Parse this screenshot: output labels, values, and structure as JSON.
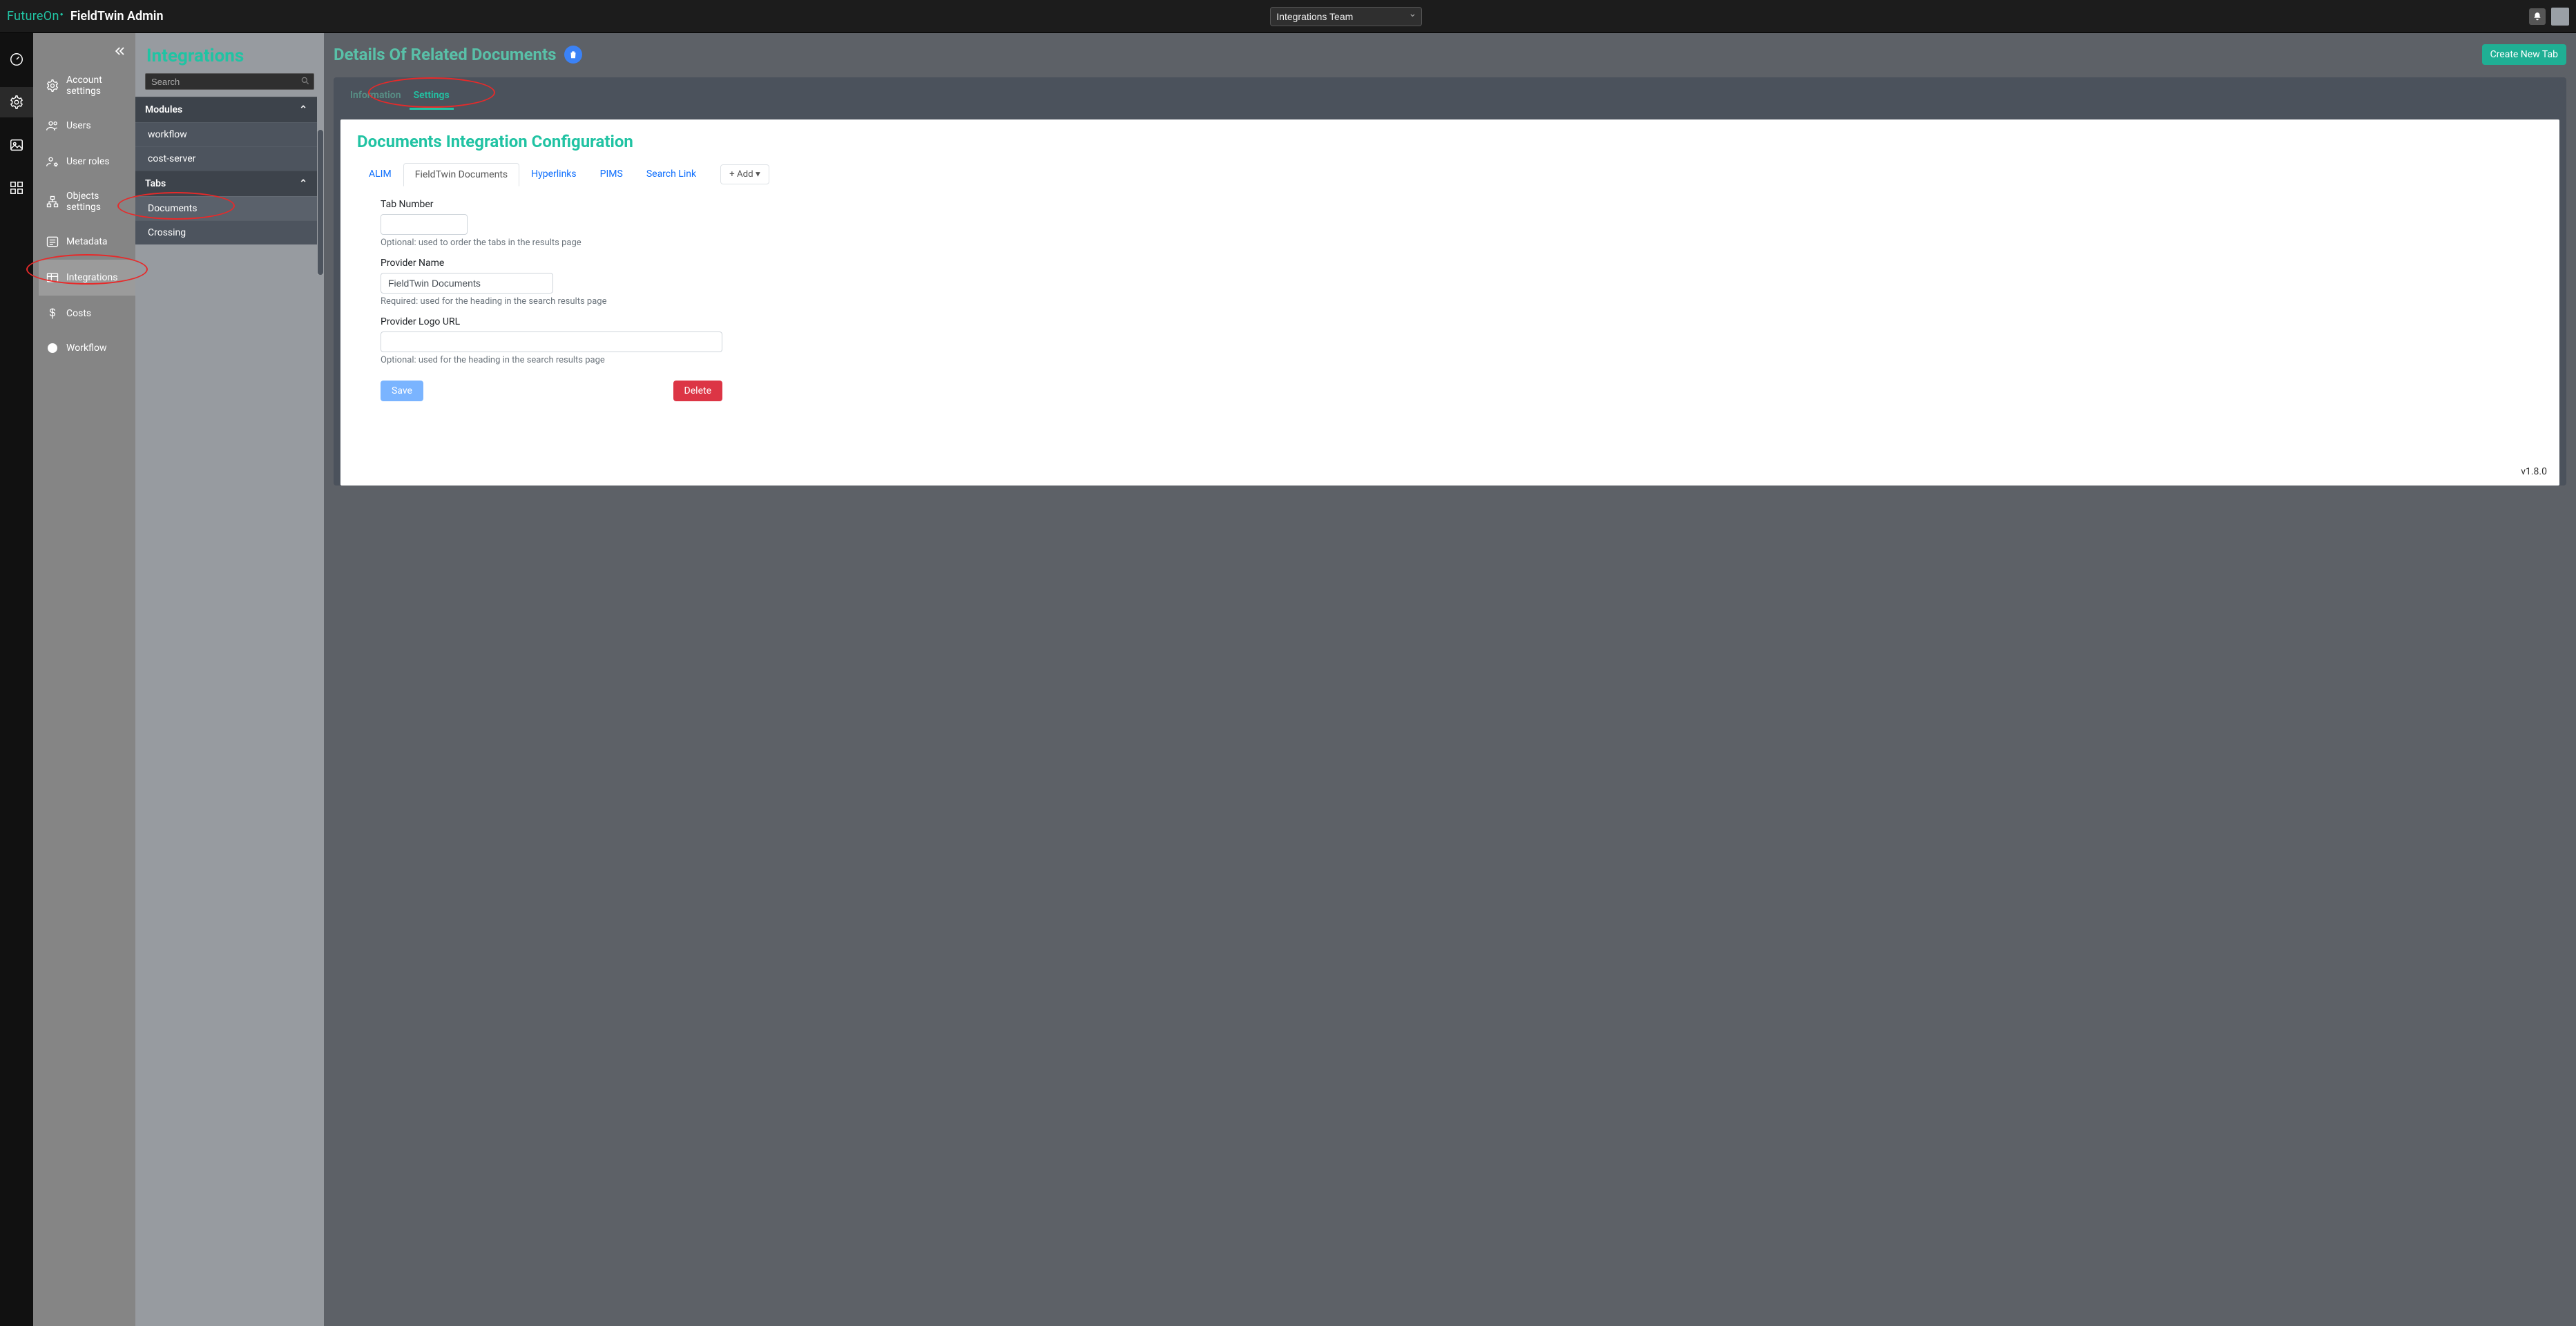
{
  "header": {
    "brand": "FutureOn",
    "app_title": "FieldTwin Admin",
    "team_selected": "Integrations Team"
  },
  "sidebar": {
    "items": [
      {
        "label": "Account settings"
      },
      {
        "label": "Users"
      },
      {
        "label": "User roles"
      },
      {
        "label": "Objects settings"
      },
      {
        "label": "Metadata"
      },
      {
        "label": "Integrations"
      },
      {
        "label": "Costs"
      },
      {
        "label": "Workflow"
      }
    ]
  },
  "tree": {
    "page_heading": "Integrations",
    "search_placeholder": "Search",
    "groups": [
      {
        "label": "Modules",
        "items": [
          "workflow",
          "cost-server"
        ]
      },
      {
        "label": "Tabs",
        "items": [
          "Documents",
          "Crossing"
        ]
      }
    ]
  },
  "main": {
    "title": "Details Of Related Documents",
    "create_btn": "Create New Tab",
    "tabs": [
      {
        "label": "Information",
        "active": false
      },
      {
        "label": "Settings",
        "active": true
      }
    ],
    "panel": {
      "title": "Documents Integration Configuration",
      "tabs": [
        "ALIM",
        "FieldTwin Documents",
        "Hyperlinks",
        "PIMS",
        "Search Link"
      ],
      "active_tab": "FieldTwin Documents",
      "add_label": "+ Add ",
      "form": {
        "tab_number_label": "Tab Number",
        "tab_number_value": "",
        "tab_number_help": "Optional: used to order the tabs in the results page",
        "provider_name_label": "Provider Name",
        "provider_name_value": "FieldTwin Documents",
        "provider_name_help": "Required: used for the heading in the search results page",
        "provider_logo_label": "Provider Logo URL",
        "provider_logo_value": "",
        "provider_logo_help": "Optional: used for the heading in the search results page",
        "save_label": "Save",
        "delete_label": "Delete"
      },
      "version": "v1.8.0"
    }
  }
}
